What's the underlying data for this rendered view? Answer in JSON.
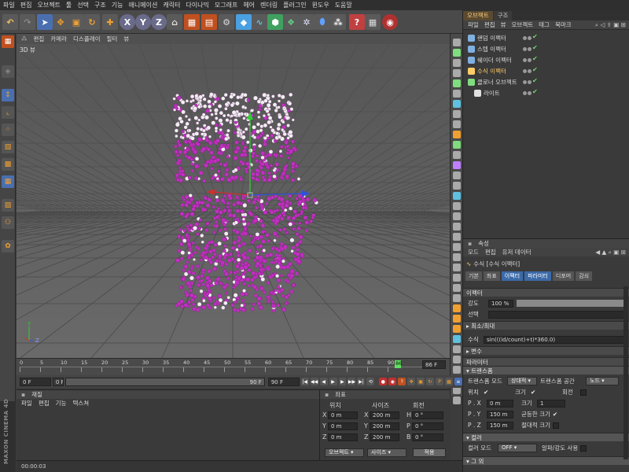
{
  "menubar": [
    "파일",
    "편집",
    "오브젝트",
    "툴",
    "선택",
    "구조",
    "기능",
    "애니메이션",
    "캐릭터",
    "다이나믹",
    "모그래프",
    "헤어",
    "렌더링",
    "플러그인",
    "윈도우",
    "도움말"
  ],
  "toolbar": {
    "x_label": "X",
    "y_label": "Y",
    "z_label": "Z"
  },
  "viewport": {
    "menu": [
      "편집",
      "카메라",
      "디스플레이",
      "필터",
      "뷰"
    ],
    "label": "3D 뷰",
    "axis_y": "Y",
    "axis_z": "Z"
  },
  "timeline": {
    "ticks": [
      "0",
      "5",
      "10",
      "15",
      "20",
      "25",
      "30",
      "35",
      "40",
      "45",
      "50",
      "55",
      "60",
      "65",
      "70",
      "75",
      "80",
      "85",
      "90"
    ],
    "current_frame_label": "86",
    "end_frame": "86 F"
  },
  "playback": {
    "start": "0 F",
    "start2": "0 F",
    "end2": "90 F",
    "end": "90 F"
  },
  "material": {
    "title": "재질",
    "menu": [
      "파일",
      "편집",
      "기능",
      "텍스쳐"
    ]
  },
  "coords": {
    "title": "좌표",
    "col_position": "위치",
    "col_size": "사이즈",
    "col_rotation": "회전",
    "rows": [
      {
        "axis": "X",
        "pos": "0 m",
        "saxis": "X",
        "size": "200 m",
        "raxis": "H",
        "rot": "0 °"
      },
      {
        "axis": "Y",
        "pos": "0 m",
        "saxis": "Y",
        "size": "200 m",
        "raxis": "P",
        "rot": "0 °"
      },
      {
        "axis": "Z",
        "pos": "0 m",
        "saxis": "Z",
        "size": "200 m",
        "raxis": "B",
        "rot": "0 °"
      }
    ],
    "mode_object": "오브젝트",
    "mode_size": "사이즈",
    "apply": "적용"
  },
  "status": {
    "time": "00:00:03"
  },
  "brand": "MAXON CINEMA 4D",
  "objects": {
    "tabs": [
      "오브젝트",
      "구조"
    ],
    "menu": [
      "파일",
      "편집",
      "뷰",
      "오브젝트",
      "태그",
      "북마크"
    ],
    "items": [
      {
        "name": "랜덤 이펙터",
        "color": "#7fb0e0"
      },
      {
        "name": "스텝 이펙터",
        "color": "#7fb0e0"
      },
      {
        "name": "쉐이더 이펙터",
        "color": "#7fb0e0"
      },
      {
        "name": "수식 이펙터",
        "color": "#ffcc66"
      },
      {
        "name": "클로너 오브젝트",
        "color": "#7fdc7f"
      },
      {
        "name": "라이트",
        "color": "#e0e0e0"
      }
    ]
  },
  "attributes": {
    "title": "속성",
    "menu": [
      "모드",
      "편집",
      "유저 데이터"
    ],
    "object_title": "수식 [수식 이펙터]",
    "tabs": [
      "기본",
      "좌표",
      "이펙터",
      "파라미터",
      "디포머",
      "감쇠"
    ],
    "effector_section": "이펙터",
    "strength_label": "강도",
    "strength_value": "100 %",
    "strength_fraction": 1.0,
    "selection_label": "선택",
    "minmax_section": "최소/최대",
    "formula_label": "수식",
    "formula_value": "sin(((id/count)+t)*360.0)",
    "variables_section": "변수",
    "params_section": "파라미터",
    "transform_section": "트랜스폼",
    "transform_mode_label": "트랜스폼 모드",
    "transform_mode_value": "상대적",
    "transform_space_label": "트랜스폼 공간",
    "transform_space_value": "노드",
    "position_label": "위치",
    "scale_label": "크기",
    "rotation_label": "회전",
    "px_label": "P . X",
    "px_value": "0 m",
    "py_label": "P . Y",
    "py_value": "150 m",
    "pz_label": "P . Z",
    "pz_value": "150 m",
    "scale2_label": "크기",
    "scale2_value": "1",
    "uniform_label": "균등한 크기",
    "absolute_label": "절대적 크기",
    "color_section": "컬러",
    "color_mode_label": "컬러 모드",
    "color_mode_value": "OFF",
    "alpha_label": "알파/강도 사용",
    "other_section": "그 외"
  },
  "colors": {
    "accent_blue": "#3b6aa8",
    "particle_magenta": "#c030c0",
    "particle_white": "#f0f0f0",
    "playhead": "#60e060"
  }
}
